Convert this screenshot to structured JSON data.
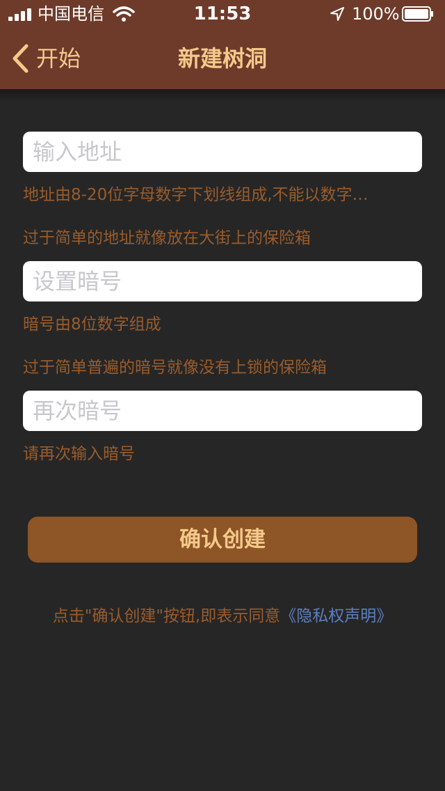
{
  "status_bar": {
    "carrier": "中国电信",
    "time": "11:53",
    "battery": "100%"
  },
  "nav": {
    "back_label": "开始",
    "title": "新建树洞"
  },
  "form": {
    "address_placeholder": "输入地址",
    "address_hint": "地址由8-20位字母数字下划线组成,不能以数字…",
    "address_tip": "过于简单的地址就像放在大街上的保险箱",
    "code_placeholder": "设置暗号",
    "code_hint": "暗号由8位数字组成",
    "code_tip": "过于简单普遍的暗号就像没有上锁的保险箱",
    "confirm_placeholder": "再次暗号",
    "confirm_hint": "请再次输入暗号"
  },
  "actions": {
    "confirm_label": "确认创建"
  },
  "agreement": {
    "text": "点击\"确认创建\"按钮,即表示同意",
    "link": "《隐私权声明》"
  },
  "colors": {
    "header": "#6e3b2a",
    "background": "#262626",
    "accent": "#f5c98a",
    "hint": "#9a5c2c",
    "button": "#8e5526",
    "link": "#5c7fc0"
  },
  "icons": {
    "signal": "cellular-signal-icon",
    "wifi": "wifi-icon",
    "location": "location-arrow-icon",
    "battery": "battery-icon",
    "back": "chevron-left-icon"
  }
}
